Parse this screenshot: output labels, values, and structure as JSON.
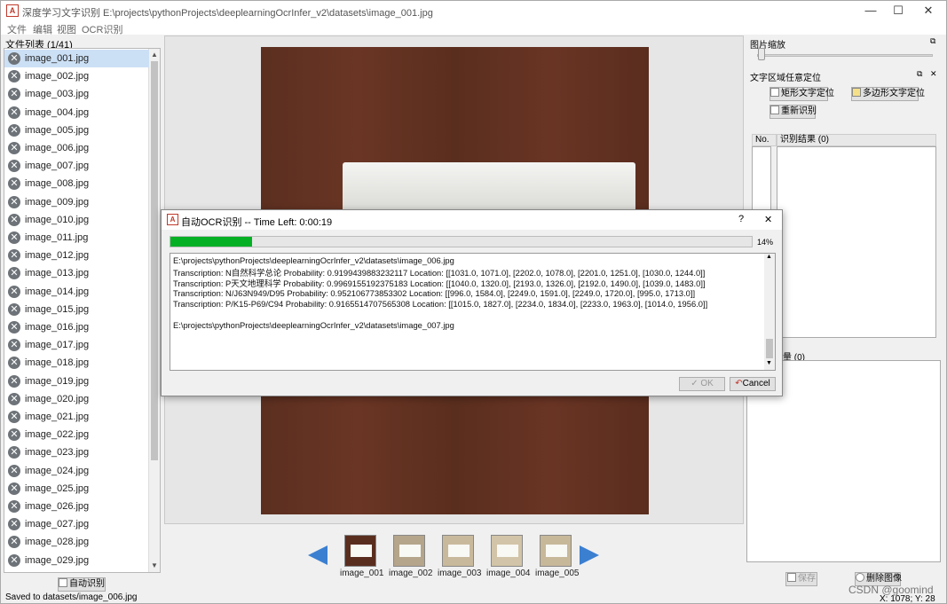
{
  "window": {
    "title": "深度学习文字识别 E:\\projects\\pythonProjects\\deeplearningOcrInfer_v2\\datasets\\image_001.jpg",
    "minimize": "—",
    "maximize": "☐",
    "close": "✕"
  },
  "menu": [
    "文件",
    "编辑",
    "视图",
    "OCR识别"
  ],
  "file_list": {
    "title": "文件列表 (1/41)",
    "items": [
      "image_001.jpg",
      "image_002.jpg",
      "image_003.jpg",
      "image_004.jpg",
      "image_005.jpg",
      "image_006.jpg",
      "image_007.jpg",
      "image_008.jpg",
      "image_009.jpg",
      "image_010.jpg",
      "image_011.jpg",
      "image_012.jpg",
      "image_013.jpg",
      "image_014.jpg",
      "image_015.jpg",
      "image_016.jpg",
      "image_017.jpg",
      "image_018.jpg",
      "image_019.jpg",
      "image_020.jpg",
      "image_021.jpg",
      "image_022.jpg",
      "image_023.jpg",
      "image_024.jpg",
      "image_025.jpg",
      "image_026.jpg",
      "image_027.jpg",
      "image_028.jpg",
      "image_029.jpg"
    ],
    "selected_index": 0,
    "auto_button": "自动识别"
  },
  "status_bar": "Saved to  datasets/image_006.jpg",
  "thumbnails": [
    "image_001",
    "image_002",
    "image_003",
    "image_004",
    "image_005"
  ],
  "zoom_panel": {
    "title": "图片缩放"
  },
  "locate_panel": {
    "title": "文字区域任意定位",
    "rect_button": "矩形文字定位",
    "poly_button": "多边形文字定位",
    "reocr_button": "重新识别",
    "col_no": "No.",
    "col_result": "识别结果 (0)"
  },
  "second_list": {
    "title": "量 (0)"
  },
  "bottom_buttons": {
    "save": "保存",
    "delete": "删除图像"
  },
  "coords": "X: 1078; Y: 28",
  "watermark": "CSDN @goomind",
  "dialog": {
    "title": "自动OCR识别  --  Time Left: 0:00:19",
    "help": "?",
    "close": "✕",
    "progress_percent": 14,
    "progress_label": "14%",
    "log_lines": [
      "E:\\projects\\pythonProjects\\deeplearningOcrInfer_v2\\datasets\\image_006.jpg",
      "Transcription: N自然科学总论 Probability: 0.9199439883232117 Location: [[1031.0, 1071.0], [2202.0, 1078.0], [2201.0, 1251.0], [1030.0, 1244.0]]",
      "Transcription: P天文地理科学 Probability: 0.9969155192375183 Location: [[1040.0, 1320.0], [2193.0, 1326.0], [2192.0, 1490.0], [1039.0, 1483.0]]",
      "Transcription: N/J63N949/D95 Probability: 0.952106773853302 Location: [[996.0, 1584.0], [2249.0, 1591.0], [2249.0, 1720.0], [995.0, 1713.0]]",
      "Transcription: P/K15-P69/C94 Probability: 0.9165514707565308 Location: [[1015.0, 1827.0], [2234.0, 1834.0], [2233.0, 1963.0], [1014.0, 1956.0]]",
      "",
      "E:\\projects\\pythonProjects\\deeplearningOcrInfer_v2\\datasets\\image_007.jpg"
    ],
    "ok": "OK",
    "cancel": "Cancel"
  }
}
